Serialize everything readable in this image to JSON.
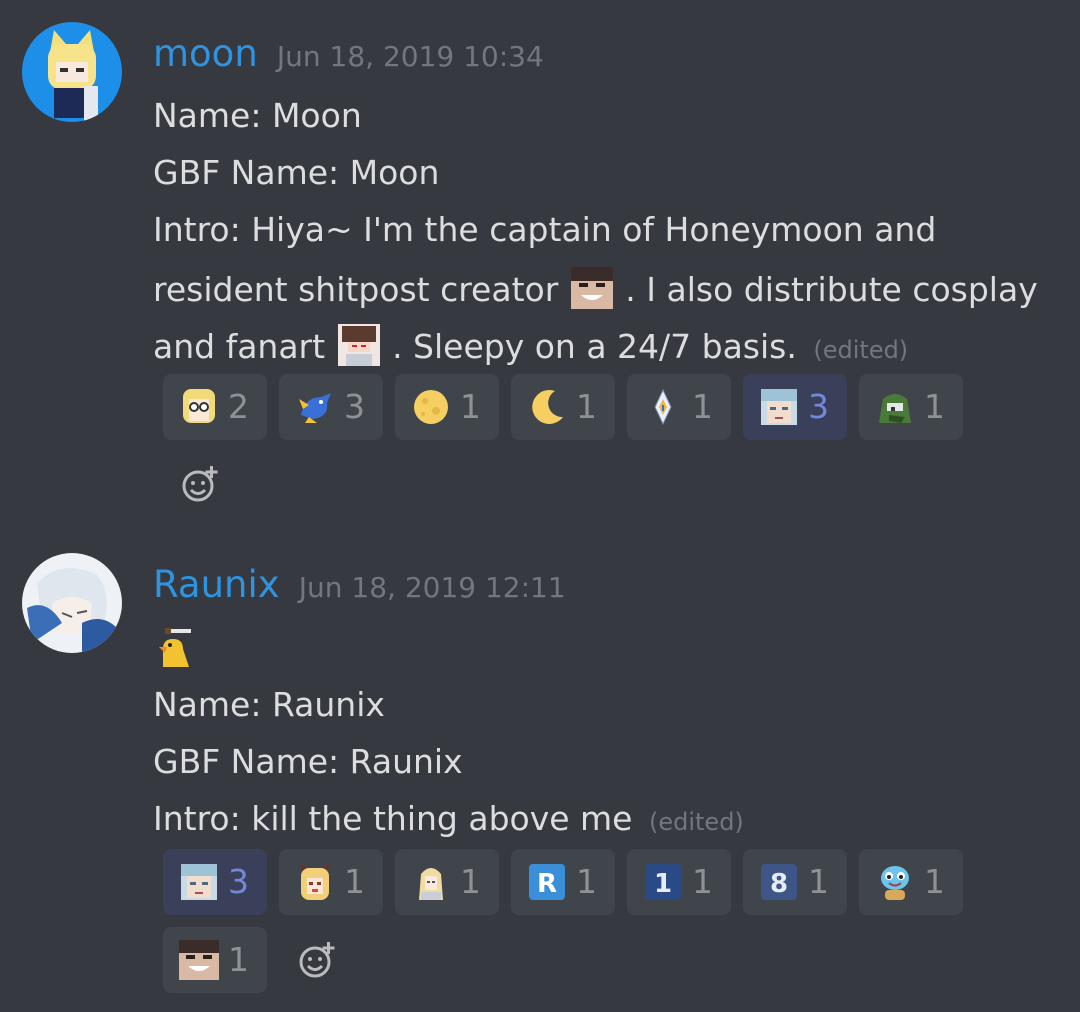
{
  "messages": [
    {
      "username": "moon",
      "timestamp": "Jun 18, 2019 10:34",
      "lines": {
        "name": "Name: Moon",
        "gbf": "GBF Name: Moon",
        "intro_1": "Intro: Hiya~ I'm the captain of Honeymoon and",
        "intro_2a": "resident shitpost creator",
        "intro_2b": ". I also distribute cosplay",
        "intro_3a": "and fanart",
        "intro_3b": ". Sleepy on a 24/7 basis."
      },
      "edited": "(edited)",
      "reactions": [
        {
          "emoji": "blonde-anime-girl-emoji",
          "count": "2",
          "me": false
        },
        {
          "emoji": "blue-dragon-emoji",
          "count": "3",
          "me": false
        },
        {
          "emoji": "full-moon-emoji",
          "count": "1",
          "me": false
        },
        {
          "emoji": "crescent-moon-emoji",
          "count": "1",
          "me": false
        },
        {
          "emoji": "crystal-emoji",
          "count": "1",
          "me": false
        },
        {
          "emoji": "silver-hair-face-emoji",
          "count": "3",
          "me": true
        },
        {
          "emoji": "green-frog-emoji",
          "count": "1",
          "me": false
        }
      ]
    },
    {
      "username": "Raunix",
      "timestamp": "Jun 18, 2019 12:11",
      "lines": {
        "name": "Name: Raunix",
        "gbf": "GBF Name: Raunix",
        "intro": "Intro: kill the thing above me"
      },
      "edited": "(edited)",
      "top_emoji": "duck-with-knife-emoji",
      "reactions": [
        {
          "emoji": "silver-hair-face-emoji",
          "count": "3",
          "me": true
        },
        {
          "emoji": "horned-girl-emoji",
          "count": "1",
          "me": false
        },
        {
          "emoji": "blonde-knight-emoji",
          "count": "1",
          "me": false
        },
        {
          "emoji": "letter-r-emoji",
          "label": "R",
          "count": "1",
          "me": false
        },
        {
          "emoji": "number-1-emoji",
          "label": "1",
          "count": "1",
          "me": false
        },
        {
          "emoji": "number-8-emoji",
          "label": "8",
          "count": "1",
          "me": false
        },
        {
          "emoji": "squirtle-emoji",
          "count": "1",
          "me": false
        },
        {
          "emoji": "grinning-man-emoji",
          "count": "1",
          "me": false
        }
      ]
    }
  ],
  "colors": {
    "background": "#36393f",
    "username": "#2f93e0",
    "timestamp": "#72767d",
    "text": "#dcddde",
    "reaction_bg": "#40444b",
    "reaction_me_bg": "#3b405a",
    "reaction_me_count": "#7289da"
  }
}
